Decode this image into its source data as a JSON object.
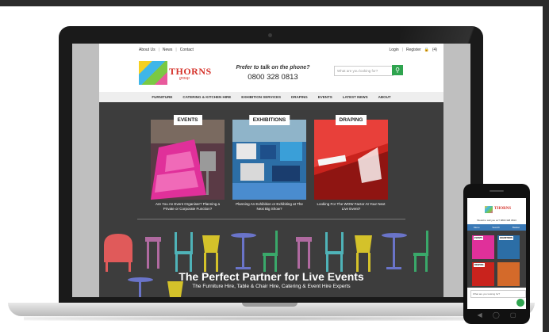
{
  "site": {
    "utility_nav": [
      "About Us",
      "News",
      "Contact"
    ],
    "account_nav": [
      "Login",
      "Register",
      "(4)"
    ],
    "logo": {
      "name": "THORNS",
      "sub": "group"
    },
    "phone_prompt": "Prefer to talk on the phone?",
    "phone_number": "0800 328 0813",
    "search_placeholder": "What are you looking for?",
    "main_nav": [
      "FURNITURE",
      "CATERING & KITCHEN HIRE",
      "EXHIBITION SERVICES",
      "DRAPING",
      "EVENTS",
      "LATEST NEWS",
      "ABOUT"
    ],
    "cards": [
      {
        "label": "EVENTS",
        "caption": "Are You An Event Organiser? Planning a Private or Corporate Function?"
      },
      {
        "label": "EXHIBITIONS",
        "caption": "Planning An Exhibition or Exhibiting at The Next Big Show?"
      },
      {
        "label": "DRAPING",
        "caption": "Looking For The WOW Factor At Your Next Live Event?"
      }
    ],
    "headline": "The Perfect Partner for Live Events",
    "subline": "The Furniture Hire, Table & Chair Hire, Catering & Event Hire Experts"
  },
  "mobile": {
    "logo": "THORNS",
    "phone_line": "Would to call you on? 0800 328 0813",
    "menu": [
      "Menu",
      "Search",
      "Basket"
    ],
    "cards": [
      "EVENTS",
      "EXHIBITIONS",
      "DRAPING"
    ],
    "search_prompt": "What are you looking for?"
  },
  "colors": {
    "accent_green": "#2fa44f",
    "brand_red": "#d5322a",
    "hero_bg": "#3d3d3d"
  }
}
